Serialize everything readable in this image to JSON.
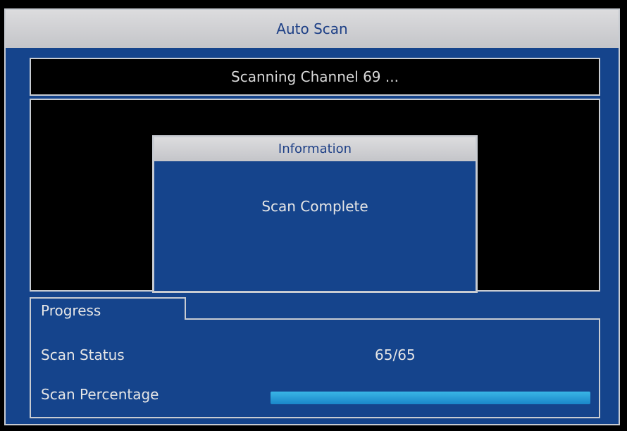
{
  "window": {
    "title": "Auto Scan"
  },
  "status_bar": {
    "text": "Scanning Channel 69 ..."
  },
  "info_dialog": {
    "title": "Information",
    "message": "Scan Complete"
  },
  "progress": {
    "tab_label": "Progress",
    "scan_status_label": "Scan Status",
    "scan_status_value": "65/65",
    "scan_percentage_label": "Scan Percentage",
    "scan_percentage_fraction": 1.0
  },
  "colors": {
    "panel_blue": "#15448c",
    "title_gray": "#c4c5c9",
    "progress_fill": "#2aa0d8"
  }
}
